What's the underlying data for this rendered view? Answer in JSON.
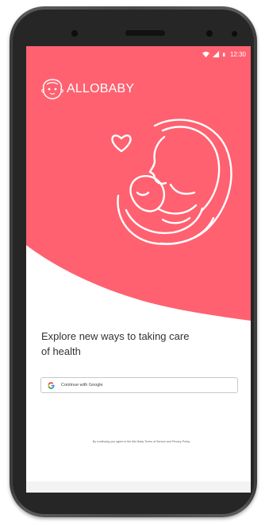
{
  "status_bar": {
    "time": "12:30",
    "icons": [
      "wifi-icon",
      "signal-icon",
      "battery-icon"
    ]
  },
  "brand": {
    "name": "ALLOBABY",
    "logo_icon": "baby-face-logo-icon"
  },
  "hero": {
    "background_color": "#ff6170",
    "illustration_icon": "mother-holding-baby-icon",
    "heart_icon": "heart-icon"
  },
  "main": {
    "tagline": "Explore new ways to taking care of health",
    "google_button": {
      "label": "Continue with Google",
      "icon": "google-g-icon"
    },
    "terms_text": "By continuing you agree to the Allo Baby Terms of Service and Privacy Policy"
  },
  "colors": {
    "accent": "#ff6170",
    "phone_frame": "#4a4a4a",
    "text_dark": "#333333"
  }
}
